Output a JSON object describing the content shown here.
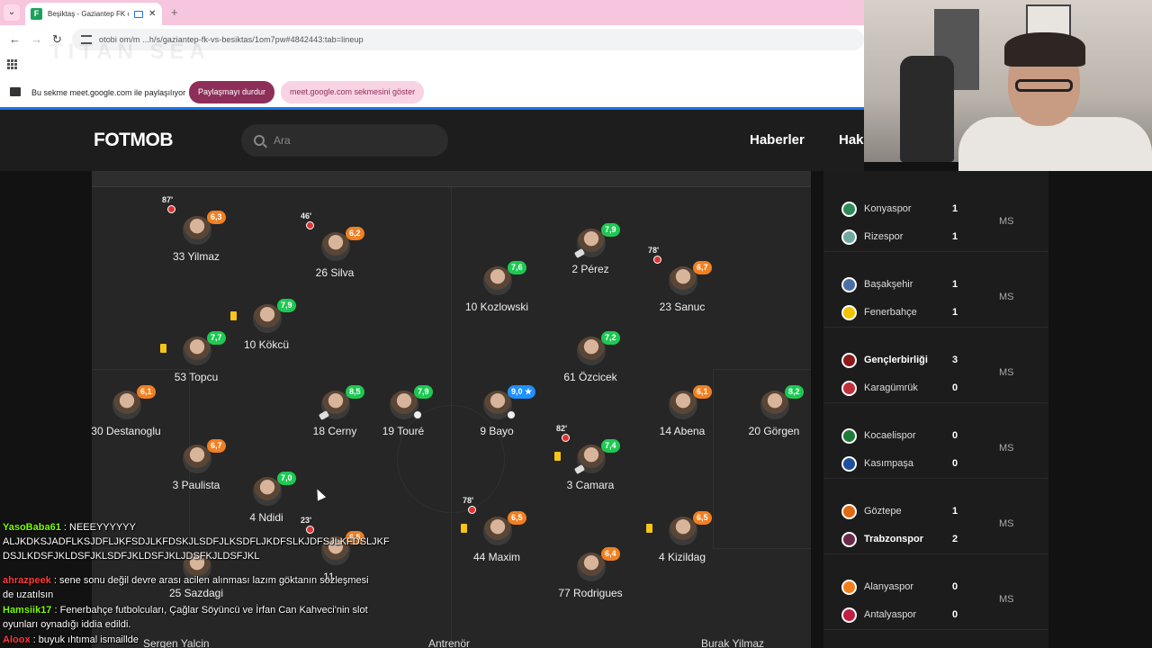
{
  "browser": {
    "tab_title": "Beşiktaş - Gaziantep FK canlı",
    "url": "otobi om/m ...h/s/gaziantep-fk-vs-besiktas/1om7pw#4842443:tab=lineup",
    "watermark": "TITAN SEA"
  },
  "sharebar": {
    "text": "Bu sekme meet.google.com ile paylaşılıyor",
    "stop_label": "Paylaşmayı durdur",
    "show_label": "meet.google.com sekmesini göster"
  },
  "fotmob": {
    "logo": "FOTMOB",
    "search_placeholder": "Ara",
    "nav": [
      "Haberler",
      "Hak"
    ]
  },
  "lineup": [
    {
      "name": "33 Yilmaz",
      "rating": "6,3",
      "color": "orange",
      "minute": "87'",
      "sub": true
    },
    {
      "name": "26 Silva",
      "rating": "6,2",
      "color": "orange",
      "minute": "46'",
      "sub": true
    },
    {
      "name": "10 Kökcü",
      "rating": "7,9",
      "color": "green",
      "card": true
    },
    {
      "name": "53 Topcu",
      "rating": "7,7",
      "color": "green",
      "card": true
    },
    {
      "name": "30 Destanoglu",
      "rating": "6,1",
      "color": "orange"
    },
    {
      "name": "18 Cerny",
      "rating": "8,5",
      "color": "green",
      "assist": true
    },
    {
      "name": "19 Touré",
      "rating": "7,9",
      "color": "green",
      "goal": true
    },
    {
      "name": "3 Paulista",
      "rating": "6,7",
      "color": "orange"
    },
    {
      "name": "4 Ndidi",
      "rating": "7,0",
      "color": "green"
    },
    {
      "name": "25 Sazdagi",
      "rating": "",
      "color": "orange"
    },
    {
      "name": "11 ...",
      "rating": "6,5",
      "color": "orange",
      "minute": "23'",
      "sub": true
    },
    {
      "name": "10 Kozlowski",
      "rating": "7,6",
      "color": "green"
    },
    {
      "name": "2 Pérez",
      "rating": "7,9",
      "color": "green",
      "assist": true
    },
    {
      "name": "23 Sanuc",
      "rating": "6,7",
      "color": "orange",
      "minute": "78'",
      "sub": true
    },
    {
      "name": "61 Özcicek",
      "rating": "7,2",
      "color": "green"
    },
    {
      "name": "9 Bayo",
      "rating": "9,0 ★",
      "color": "blue",
      "goal": true
    },
    {
      "name": "14 Abena",
      "rating": "6,1",
      "color": "orange"
    },
    {
      "name": "20 Görgen",
      "rating": "8,2",
      "color": "green"
    },
    {
      "name": "3 Camara",
      "rating": "7,4",
      "color": "green",
      "minute": "82'",
      "sub": true,
      "card": true,
      "assist": true
    },
    {
      "name": "44 Maxim",
      "rating": "6,5",
      "color": "orange",
      "minute": "78'",
      "sub": true,
      "card": true
    },
    {
      "name": "4 Kizildag",
      "rating": "6,5",
      "color": "orange",
      "card": true
    },
    {
      "name": "77 Rodrigues",
      "rating": "6,4",
      "color": "orange"
    }
  ],
  "coaches": {
    "left": "Sergen Yalcin",
    "middle": "Antrenör",
    "right": "Burak Yilmaz"
  },
  "results": [
    {
      "home": "Konyaspor",
      "home_score": "1",
      "away": "Rizespor",
      "away_score": "1",
      "status": "MS",
      "winner": ""
    },
    {
      "home": "Başakşehir",
      "home_score": "1",
      "away": "Fenerbahçe",
      "away_score": "1",
      "status": "MS",
      "winner": ""
    },
    {
      "home": "Gençlerbirliği",
      "home_score": "3",
      "away": "Karagümrük",
      "away_score": "0",
      "status": "MS",
      "winner": "home"
    },
    {
      "home": "Kocaelispor",
      "home_score": "0",
      "away": "Kasımpaşa",
      "away_score": "0",
      "status": "MS",
      "winner": ""
    },
    {
      "home": "Göztepe",
      "home_score": "1",
      "away": "Trabzonspor",
      "away_score": "2",
      "status": "MS",
      "winner": "away"
    },
    {
      "home": "Alanyaspor",
      "home_score": "0",
      "away": "Antalyaspor",
      "away_score": "0",
      "status": "MS",
      "winner": ""
    }
  ],
  "team_colors": [
    "#2e8b57",
    "#6fa8a0",
    "#4a6fa5",
    "#f2c300",
    "#8b1a1a",
    "#c0303a",
    "#1f7a3a",
    "#1c4f9c",
    "#e06a12",
    "#6b2a4a",
    "#f07f1a",
    "#c02040"
  ],
  "chat": [
    {
      "user": "YasoBaba61",
      "text": " : NEEEYYYYYY ALJKDKSJADFLKSJDFLJKFSDJLKFDSKJLSDFJLKSDFLJKDFSLKJDFSJLKFDSLJKF DSJLKDSFJKLDSFJKLSDFJKLDSFJKLJDSFKJLDSFJKL",
      "color": "#7cfc00"
    },
    {
      "user": "ahrazpeek",
      "text": " : sene sonu değil devre arası acilen alınması lazım göktanın sözleşmesi de uzatılsın",
      "color": "#ff3b3b"
    },
    {
      "user": "Hamsiik17",
      "text": " : Fenerbahçe futbolcuları, Çağlar Söyüncü ve İrfan Can Kahveci'nin slot oyunları oynadığı iddia edildi.",
      "color": "#7cfc00"
    },
    {
      "user": "Aloox",
      "text": " : buyuk ıhtımal ismaillde",
      "color": "#ff3b3b"
    }
  ]
}
